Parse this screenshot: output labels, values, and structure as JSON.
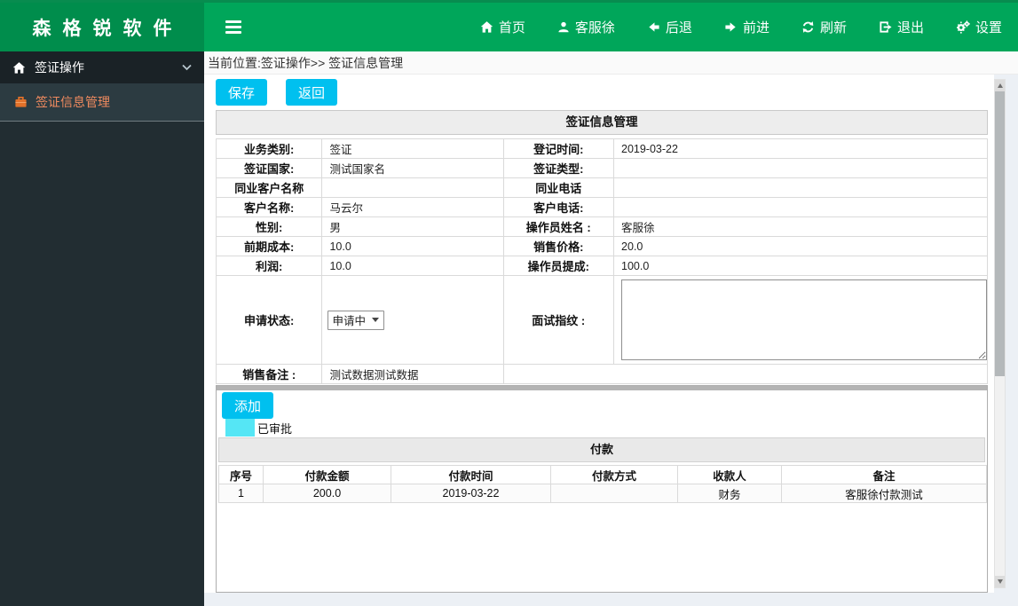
{
  "header": {
    "brand": "森格锐软件",
    "nav": [
      {
        "label": "首页",
        "icon": "home-icon"
      },
      {
        "label": "客服徐",
        "icon": "user-icon"
      },
      {
        "label": "后退",
        "icon": "arrow-left-icon"
      },
      {
        "label": "前进",
        "icon": "arrow-right-icon"
      },
      {
        "label": "刷新",
        "icon": "refresh-icon"
      },
      {
        "label": "退出",
        "icon": "logout-icon"
      },
      {
        "label": "设置",
        "icon": "gears-icon"
      }
    ]
  },
  "sidebar": {
    "menu_visa_ops": "签证操作",
    "submenu_visa_info": "签证信息管理"
  },
  "breadcrumb": "当前位置:签证操作>> 签证信息管理",
  "toolbar": {
    "save": "保存",
    "back": "返回"
  },
  "form": {
    "title": "签证信息管理",
    "rows": [
      {
        "l1": "业务类别:",
        "v1": "签证",
        "l2": "登记时间:",
        "v2": "2019-03-22"
      },
      {
        "l1": "签证国家:",
        "v1": "测试国家名",
        "l2": "签证类型:",
        "v2": ""
      },
      {
        "l1": "同业客户名称",
        "v1": "",
        "l2": "同业电话",
        "v2": ""
      },
      {
        "l1": "客户名称:",
        "v1": "马云尔",
        "l2": "客户电话:",
        "v2": ""
      },
      {
        "l1": "性别:",
        "v1": "男",
        "l2": "操作员姓名 :",
        "v2": "客服徐"
      },
      {
        "l1": "前期成本:",
        "v1": "10.0",
        "l2": "销售价格:",
        "v2": "20.0"
      },
      {
        "l1": "利润:",
        "v1": "10.0",
        "l2": "操作员提成:",
        "v2": "100.0"
      }
    ],
    "status_row": {
      "label": "申请状态:",
      "select_value": "申请中",
      "fingerprint_label": "面试指纹 :",
      "fingerprint_value": ""
    },
    "note_row": {
      "label": "销售备注 :",
      "value": "测试数据测试数据"
    }
  },
  "payments": {
    "add_label": "添加",
    "legend_label": "已审批",
    "title": "付款",
    "columns": [
      "序号",
      "付款金额",
      "付款时间",
      "付款方式",
      "收款人",
      "备注"
    ],
    "rows": [
      [
        "1",
        "200.0",
        "2019-03-22",
        "",
        "财务",
        "客服徐付款测试"
      ]
    ]
  },
  "colors": {
    "header_green": "#00a65a",
    "brand_green": "#008d4c",
    "sidebar_dark": "#222d32",
    "active_item_orange": "#ef8a5f",
    "button_cyan": "#00c0ef",
    "approved_legend_cyan": "#55e6f5"
  }
}
